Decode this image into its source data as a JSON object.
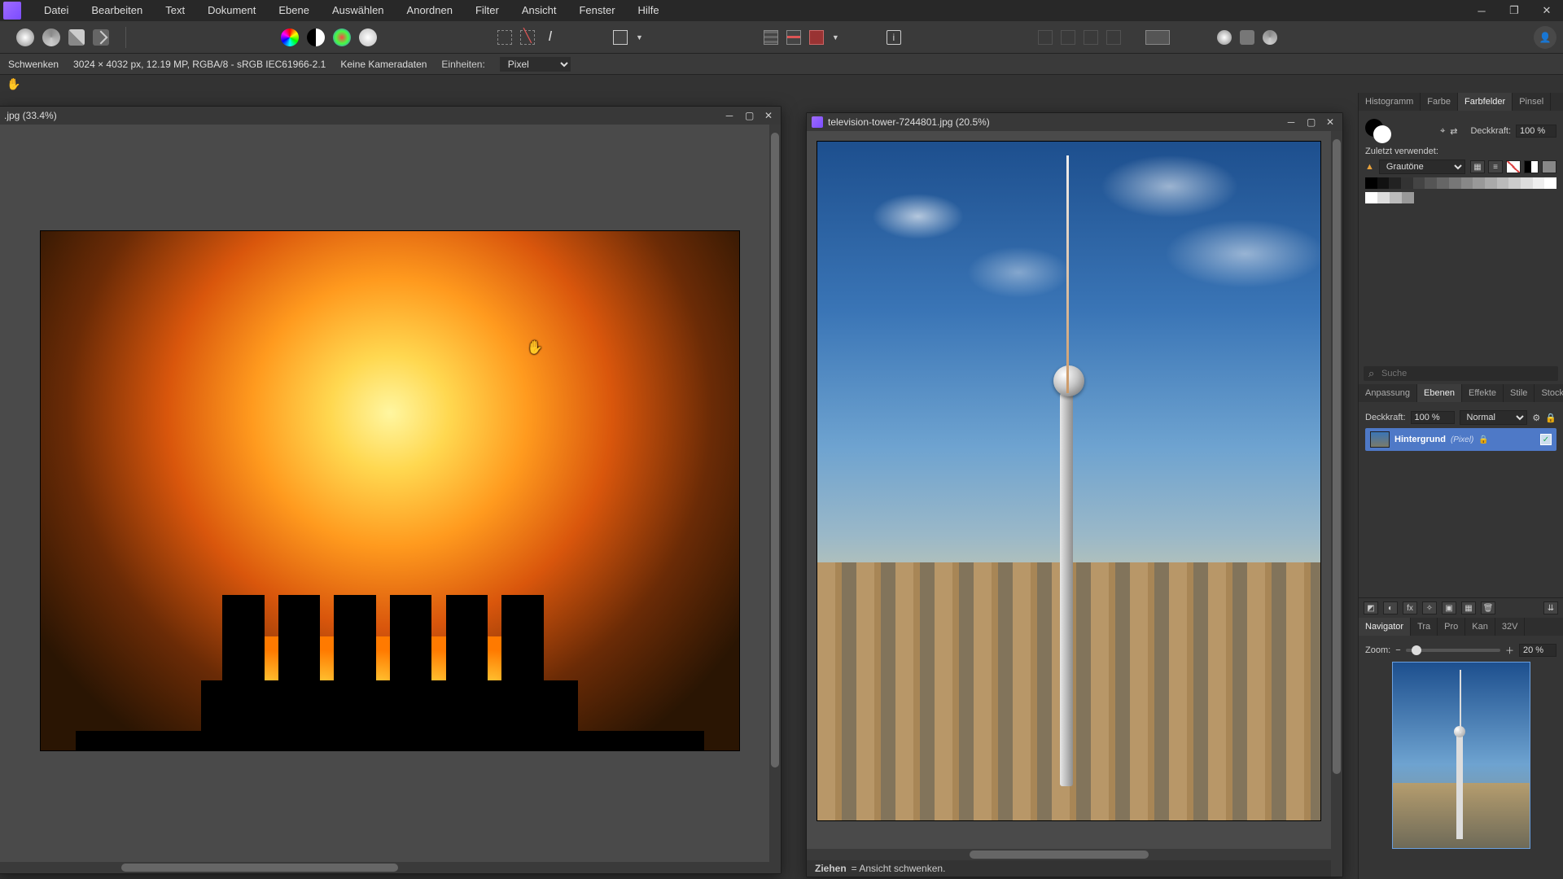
{
  "menubar": [
    "Datei",
    "Bearbeiten",
    "Text",
    "Dokument",
    "Ebene",
    "Auswählen",
    "Anordnen",
    "Filter",
    "Ansicht",
    "Fenster",
    "Hilfe"
  ],
  "window_buttons": [
    "─",
    "❐",
    "✕"
  ],
  "context": {
    "tool": "Schwenken",
    "docinfo": "3024 × 4032 px, 12.19 MP, RGBA/8 - sRGB IEC61966-2.1",
    "camera": "Keine Kameradaten",
    "units_label": "Einheiten:",
    "units_value": "Pixel"
  },
  "docs": {
    "left": {
      "title": ".jpg (33.4%)"
    },
    "right": {
      "title": "television-tower-7244801.jpg (20.5%)",
      "status_bold": "Ziehen",
      "status_rest": "= Ansicht schwenken."
    }
  },
  "dock": {
    "tabs1": [
      "Histogramm",
      "Farbe",
      "Farbfelder",
      "Pinsel"
    ],
    "tabs1_active": 2,
    "opacity_label": "Deckkraft:",
    "opacity_value": "100 %",
    "recent_label": "Zuletzt verwendet:",
    "palette": "Grautöne",
    "search_placeholder": "Suche",
    "tabs2": [
      "Anpassung",
      "Ebenen",
      "Effekte",
      "Stile",
      "Stock"
    ],
    "tabs2_active": 1,
    "layers": {
      "opacity_label": "Deckkraft:",
      "opacity_value": "100 %",
      "blend": "Normal",
      "layer_name": "Hintergrund",
      "layer_type": "(Pixel)"
    },
    "tabs3": [
      "Navigator",
      "Tra",
      "Pro",
      "Kan",
      "32V"
    ],
    "tabs3_active": 0,
    "nav": {
      "zoom_label": "Zoom:",
      "zoom_value": "20 %"
    }
  }
}
